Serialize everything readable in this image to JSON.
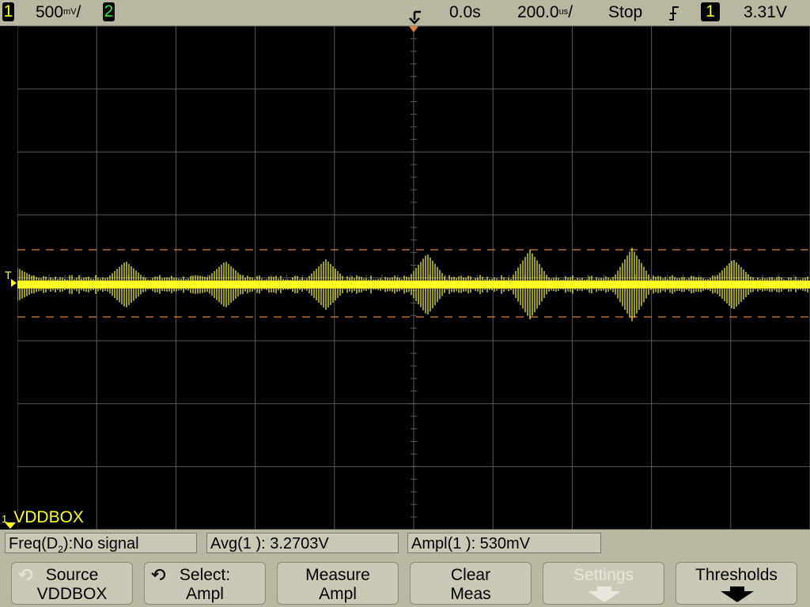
{
  "status_bar": {
    "ch1_number": "1",
    "ch1_scale": "500",
    "ch1_scale_unit": "mV",
    "ch1_scale_suffix": "/",
    "ch2_number": "2",
    "time_position": "0.0s",
    "time_scale": "200.0",
    "time_scale_unit": "us",
    "time_scale_suffix": "/",
    "run_state": "Stop",
    "trigger_source": "1",
    "trigger_level": "3.31V"
  },
  "screen": {
    "channel_label_number": "1",
    "channel_label": "VDDBOX",
    "trigger_marker": "T"
  },
  "measurements": {
    "freq_prefix": "Freq(D",
    "freq_sub": "2",
    "freq_suffix": "):No signal",
    "avg": "Avg(1 ): 3.2703V",
    "ampl": "Ampl(1 ): 530mV"
  },
  "softkeys": {
    "source_l1": "Source",
    "source_l2": "VDDBOX",
    "select_l1": "Select:",
    "select_l2": "Ampl",
    "measure_l1": "Measure",
    "measure_l2": "Ampl",
    "clear_l1": "Clear",
    "clear_l2": "Meas",
    "settings_l1": "Settings",
    "thresholds_l1": "Thresholds"
  },
  "colors": {
    "ch1": "#ffff22",
    "ch2": "#38e838",
    "grid": "#5a5a5a",
    "cursor": "#d9833a",
    "panel": "#b9b6a2"
  }
}
